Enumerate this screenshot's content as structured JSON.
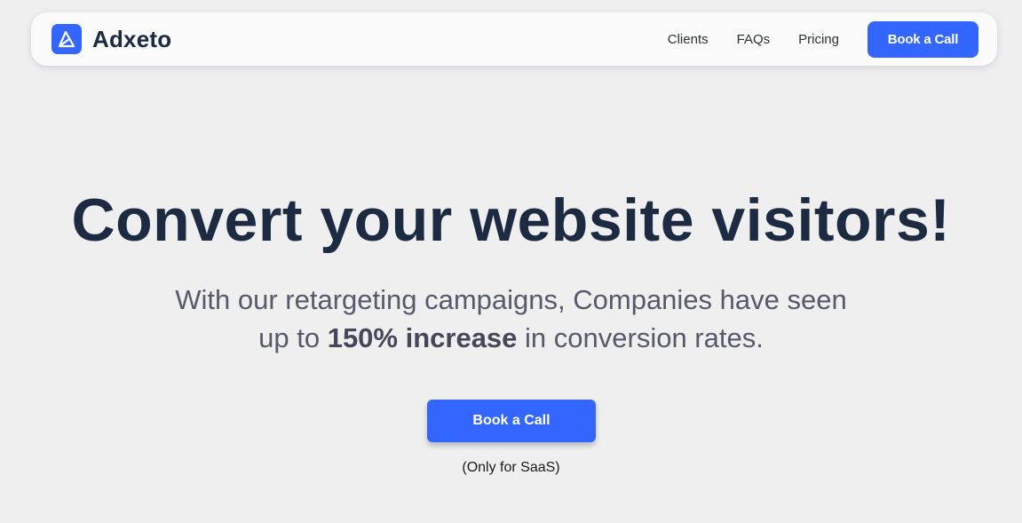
{
  "brand": {
    "name": "Adxeto",
    "logo_icon": "a-triangle-logo-icon",
    "accent_color": "#3366ff"
  },
  "nav": {
    "links": [
      "Clients",
      "FAQs",
      "Pricing"
    ],
    "cta_label": "Book a Call"
  },
  "hero": {
    "headline": "Convert your website visitors!",
    "subhead_line1": "With our retargeting campaigns, Companies have seen",
    "subhead_line2_prefix": "up to ",
    "subhead_line2_bold": "150% increase",
    "subhead_line2_suffix": " in conversion rates.",
    "cta_label": "Book a Call",
    "note": "(Only for SaaS)"
  },
  "colors": {
    "background": "#efefef",
    "heading": "#1c2b42",
    "subtext": "#565a6a",
    "button": "#3366ff"
  }
}
